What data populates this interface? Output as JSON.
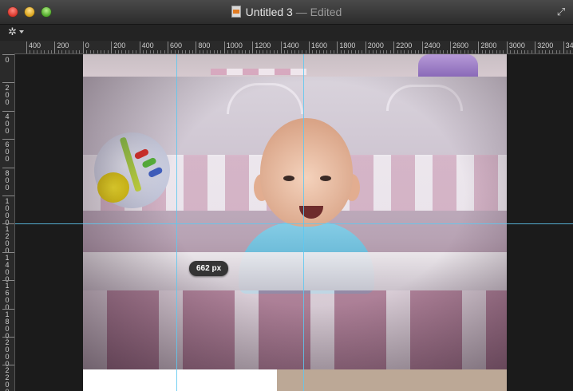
{
  "window": {
    "title": "Untitled 3",
    "edited_label": "— Edited",
    "doc_icon": "image-document-icon",
    "fullscreen_icon": "fullscreen-arrows-icon"
  },
  "toolbar": {
    "gear_icon": "gear-icon",
    "gear_glyph": "✲"
  },
  "rulers": {
    "horizontal_labels": [
      "400",
      "200",
      "0",
      "200",
      "400",
      "600",
      "800",
      "1000",
      "1200",
      "1400",
      "1600",
      "1800",
      "2000",
      "2200",
      "2400",
      "2600",
      "2800",
      "3000",
      "3200",
      "34"
    ],
    "vertical_labels": [
      "0",
      "200",
      "400",
      "600",
      "800",
      "1000",
      "1200",
      "1400",
      "1600",
      "1800",
      "2000",
      "2200"
    ]
  },
  "canvas": {
    "measurement_label": "662 px"
  },
  "colors": {
    "guide": "#5ec8f0",
    "close": "#d8352a",
    "minimize": "#d9a21a",
    "maximize": "#4fa82a"
  }
}
